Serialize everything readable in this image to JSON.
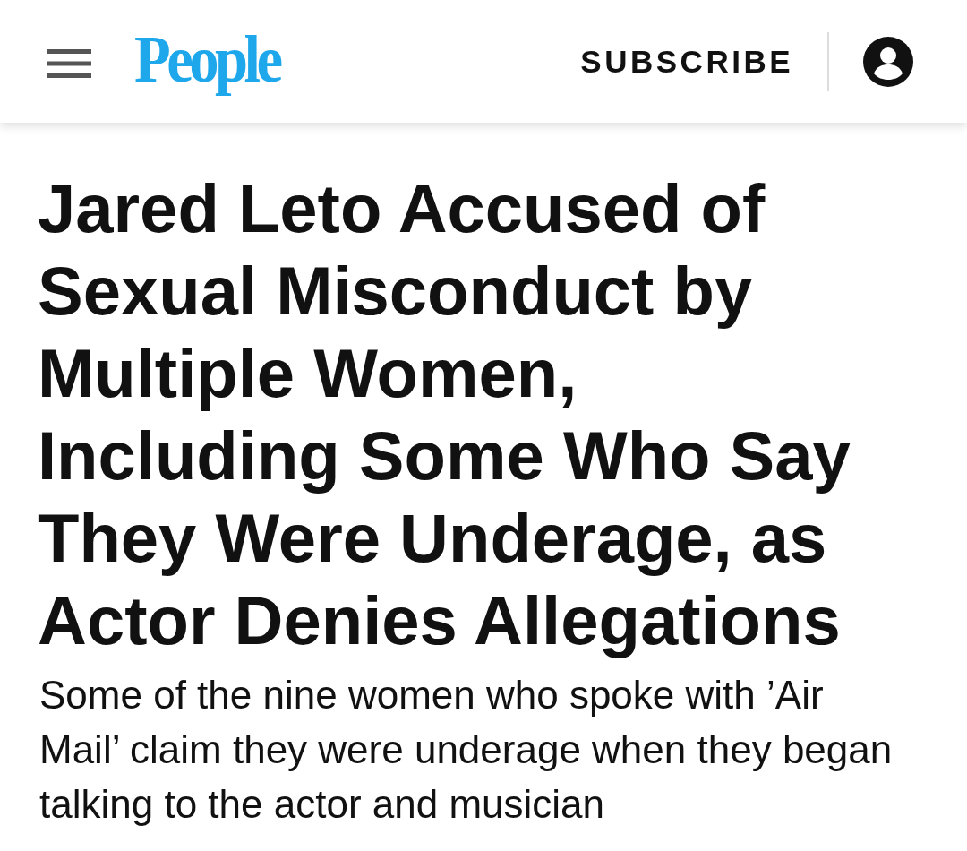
{
  "header": {
    "logo": "People",
    "subscribe_link": "SUBSCRIBE"
  },
  "article": {
    "headline": "Jared Leto Accused of Sexual Misconduct by Multiple Women, Including Some Who Say They Were Underage, as Actor Denies Allegations",
    "subheadline": "Some of the nine women who spoke with ’Air Mail’ claim they were underage when they began talking to the actor and musician"
  }
}
